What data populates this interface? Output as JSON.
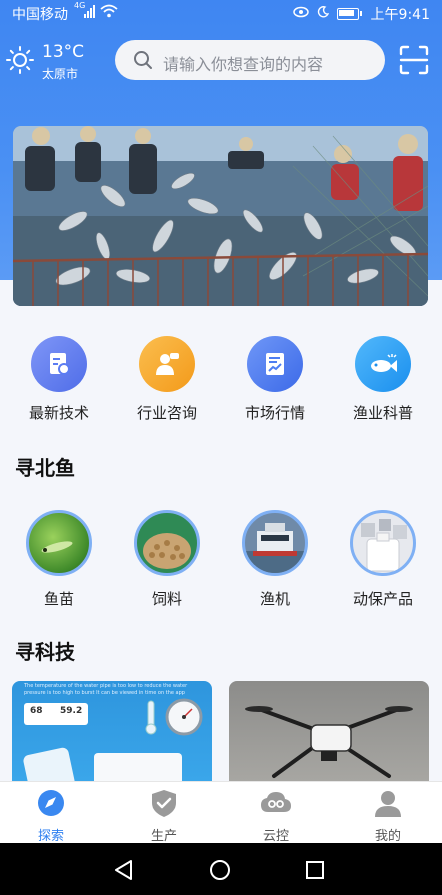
{
  "status_bar": {
    "carrier": "中国移动",
    "network": "4G",
    "time": "上午9:41"
  },
  "weather": {
    "temperature": "13°C",
    "city": "太原市"
  },
  "search": {
    "placeholder": "请输入你想查询的内容"
  },
  "quick_menu": [
    {
      "label": "最新技术",
      "icon": "document-icon",
      "color": "#5b7cf2"
    },
    {
      "label": "行业咨询",
      "icon": "consult-icon",
      "color": "#f5a623"
    },
    {
      "label": "市场行情",
      "icon": "market-icon",
      "color": "#4e7ef2"
    },
    {
      "label": "渔业科普",
      "icon": "fish-icon",
      "color": "#2b9cf2"
    }
  ],
  "sections": {
    "north_fish": "寻北鱼",
    "tech": "寻科技"
  },
  "products": [
    {
      "label": "鱼苗"
    },
    {
      "label": "饲料"
    },
    {
      "label": "渔机"
    },
    {
      "label": "动保产品"
    }
  ],
  "tech_card": {
    "caption": "The temperature of the water pipe is too low to reduce the water pressure is too high to burst It can be viewed in time on the app",
    "reading_1": "68",
    "reading_2": "59.2"
  },
  "bottom_nav": [
    {
      "label": "探索",
      "icon": "compass-icon",
      "active": true
    },
    {
      "label": "生产",
      "icon": "shield-check-icon",
      "active": false
    },
    {
      "label": "云控",
      "icon": "cloud-icon",
      "active": false
    },
    {
      "label": "我的",
      "icon": "user-icon",
      "active": false
    }
  ],
  "colors": {
    "header_blue": "#4a90f3",
    "active": "#2d7ff0"
  }
}
